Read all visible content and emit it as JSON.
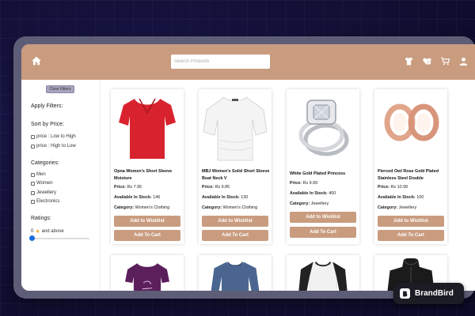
{
  "search": {
    "placeholder": "Search Products"
  },
  "top_icons": [
    "home-icon",
    "tshirt-icon",
    "wishlist-icon",
    "cart-icon",
    "user-icon"
  ],
  "sidebar": {
    "clear_filters": "Clear Filters",
    "apply_filters": "Apply Filters:",
    "sort_label": "Sort by Price:",
    "sort_options": [
      "price : Low to High",
      "price : High to Low"
    ],
    "categories_label": "Categories:",
    "categories": [
      "Men",
      "Women",
      "Jewellery",
      "Electronics"
    ],
    "ratings_label": "Ratings:",
    "ratings_value": "0",
    "ratings_suffix": "and above",
    "ratings_level": 0
  },
  "products": [
    {
      "title": "Opna Women's Short Sleeve Moisture",
      "price_label": "Price:",
      "price": "Rs 7.95",
      "stock_label": "Available In Stock:",
      "stock": "146",
      "category_label": "Category:",
      "category": "Women's Clothing",
      "wishlist": "Add to Wishlist",
      "cart": "Add To Cart"
    },
    {
      "title": "MBJ Women's Solid Short Sleeve Boat Neck V",
      "price_label": "Price:",
      "price": "Rs 9.85",
      "stock_label": "Available In Stock:",
      "stock": "130",
      "category_label": "Category:",
      "category": "Women's Clothing",
      "wishlist": "Add to Wishlist",
      "cart": "Add To Cart"
    },
    {
      "title": "White Gold Plated Princess",
      "price_label": "Price:",
      "price": "Rs 9.99",
      "stock_label": "Available In Stock:",
      "stock": "400",
      "category_label": "Category:",
      "category": "Jewellery",
      "wishlist": "Add to Wishlist",
      "cart": "Add To Cart"
    },
    {
      "title": "Pierced Owl Rose Gold Plated Stainless Steel Double",
      "price_label": "Price:",
      "price": "Rs 10.99",
      "stock_label": "Available In Stock:",
      "stock": "100",
      "category_label": "Category:",
      "category": "Jewellery",
      "wishlist": "Add to Wishlist",
      "cart": "Add To Cart"
    }
  ],
  "colors": {
    "accent": "#c99c7f",
    "background": "#121036",
    "slider": "#1a6ee0"
  },
  "badge": {
    "text": "BrandBird"
  }
}
